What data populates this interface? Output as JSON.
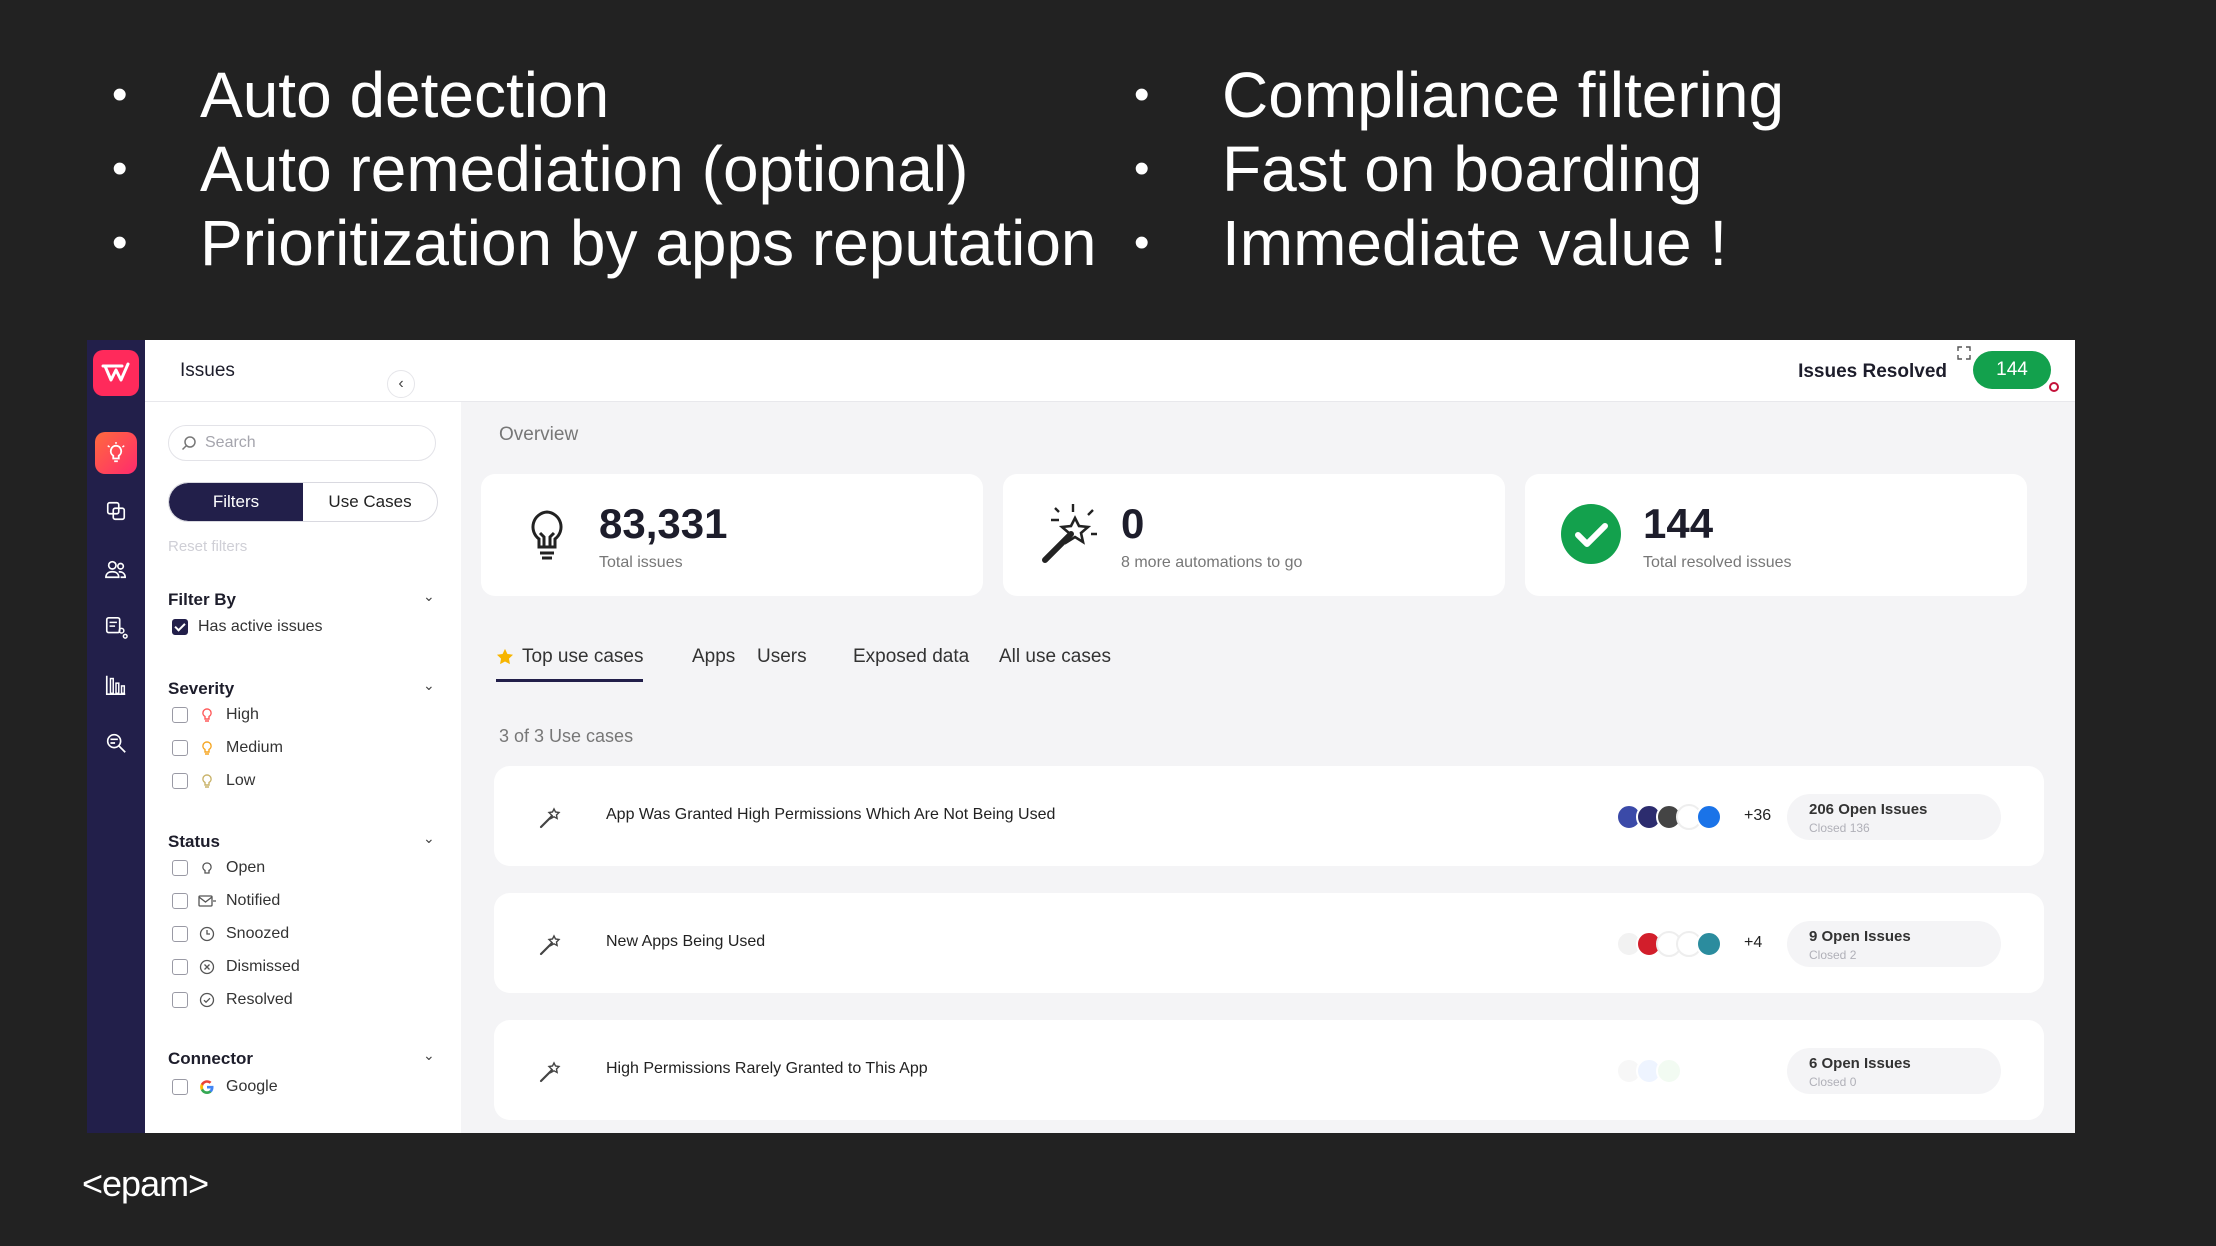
{
  "slide": {
    "bullets_left": [
      "Auto detection",
      "Auto remediation (optional)",
      "Prioritization by apps reputation"
    ],
    "bullets_right": [
      "Compliance filtering",
      "Fast on boarding",
      "Immediate value !"
    ],
    "bullet_char": "•",
    "footer_logo": "<epam>"
  },
  "app": {
    "title": "Issues",
    "issues_resolved_label": "Issues Resolved",
    "issues_resolved_count": "144",
    "rail_icons": [
      "lightbulb-icon",
      "copy-icon",
      "users-icon",
      "connectors-icon",
      "bar-chart-icon",
      "investigate-icon"
    ],
    "filters": {
      "search_placeholder": "Search",
      "collapse": "‹",
      "tabs": [
        "Filters",
        "Use Cases"
      ],
      "reset": "Reset filters",
      "filter_by": {
        "title": "Filter By",
        "options": [
          "Has active issues"
        ]
      },
      "severity": {
        "title": "Severity",
        "options": [
          "High",
          "Medium",
          "Low"
        ]
      },
      "status": {
        "title": "Status",
        "options": [
          "Open",
          "Notified",
          "Snoozed",
          "Dismissed",
          "Resolved"
        ]
      },
      "connector": {
        "title": "Connector",
        "options": [
          "Google"
        ]
      },
      "chevron": "⌄"
    },
    "overview": {
      "title": "Overview",
      "cards": [
        {
          "value": "83,331",
          "label": "Total issues",
          "icon": "lightbulb-icon"
        },
        {
          "value": "0",
          "label": "8 more automations to go",
          "icon": "magic-wand-icon"
        },
        {
          "value": "144",
          "label": "Total resolved issues",
          "icon": "check-circle-icon"
        }
      ]
    },
    "tabs": [
      "Top use cases",
      "Apps",
      "Users",
      "Exposed data",
      "All use cases"
    ],
    "use_case_count": "3 of 3 Use cases",
    "use_cases": [
      {
        "name": "App Was Granted High Permissions Which Are Not Being Used",
        "more": "+36",
        "open": "206 Open Issues",
        "closed": "Closed 136"
      },
      {
        "name": "New Apps Being Used",
        "more": "+4",
        "open": "9 Open Issues",
        "closed": "Closed 2"
      },
      {
        "name": "High Permissions Rarely Granted to This App",
        "more": "",
        "open": "6 Open Issues",
        "closed": "Closed 0"
      }
    ],
    "colors": {
      "rail": "#221f4a",
      "accent": "#ff2a5b",
      "success": "#13a14d"
    }
  }
}
